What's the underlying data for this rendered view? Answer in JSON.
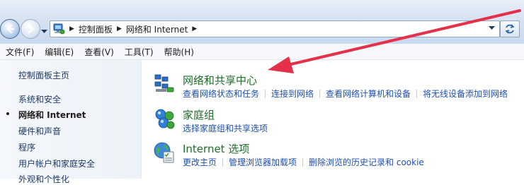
{
  "addressbar": {
    "breadcrumbs": [
      "控制面板",
      "网络和 Internet"
    ]
  },
  "menubar": {
    "items": [
      "文件(F)",
      "编辑(E)",
      "查看(V)",
      "工具(T)",
      "帮助(H)"
    ]
  },
  "sidebar": {
    "items": [
      {
        "label": "控制面板主页",
        "active": false
      },
      {
        "label": "系统和安全",
        "active": false
      },
      {
        "label": "网络和 Internet",
        "active": true
      },
      {
        "label": "硬件和声音",
        "active": false
      },
      {
        "label": "程序",
        "active": false
      },
      {
        "label": "用户帐户和家庭安全",
        "active": false
      },
      {
        "label": "外观和个性化",
        "active": false
      }
    ]
  },
  "categories": [
    {
      "title": "网络和共享中心",
      "icon": "network-center-icon",
      "links": [
        "查看网络状态和任务",
        "连接到网络",
        "查看网络计算机和设备",
        "将无线设备添加到网络"
      ]
    },
    {
      "title": "家庭组",
      "icon": "homegroup-icon",
      "links": [
        "选择家庭组和共享选项"
      ]
    },
    {
      "title": "Internet 选项",
      "icon": "internet-options-icon",
      "links": [
        "更改主页",
        "管理浏览器加载项",
        "删除浏览的历史记录和 cookie"
      ]
    }
  ],
  "colors": {
    "annotation_arrow": "#e5304a",
    "category_title": "#1e6e2a",
    "link": "#1e4fb0"
  }
}
